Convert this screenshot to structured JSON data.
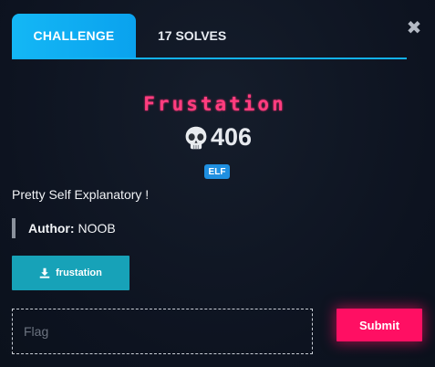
{
  "tabs": {
    "challenge_label": "CHALLENGE",
    "solves_label": "17 SOLVES"
  },
  "close_icon": "close-icon",
  "challenge": {
    "name": "Frustation",
    "points": "406",
    "points_icon": "skull-icon",
    "tag": "ELF",
    "description": "Pretty Self Explanatory !",
    "author_label": "Author:",
    "author": "NOOB"
  },
  "download": {
    "label": "frustation",
    "icon": "download-icon"
  },
  "flag_form": {
    "placeholder": "Flag",
    "submit_label": "Submit"
  },
  "colors": {
    "accent_blue": "#12b2f3",
    "title_pink": "#ff3d7f",
    "submit_pink": "#ff0f63",
    "download_teal": "#17a2b8",
    "tag_blue": "#1f8fe0",
    "background": "#0d1320"
  }
}
